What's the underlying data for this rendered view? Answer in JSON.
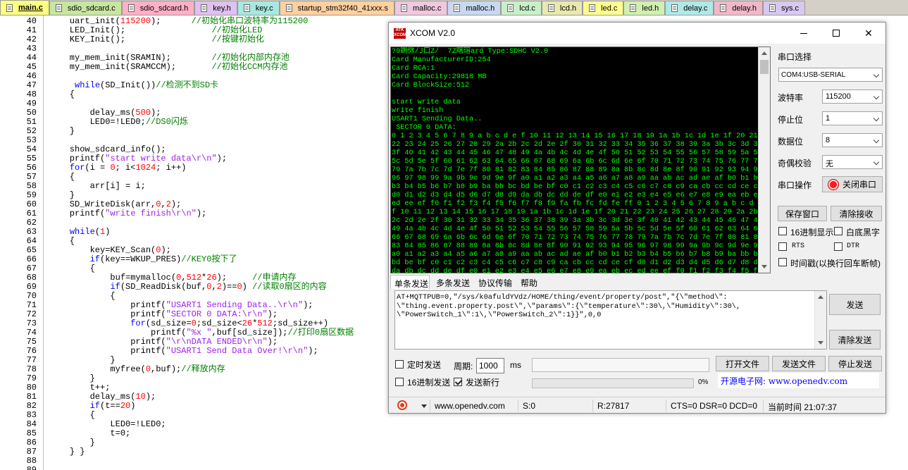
{
  "tabs": [
    {
      "label": "main.c",
      "color": "#ffff80",
      "active": true
    },
    {
      "label": "sdio_sdcard.c",
      "color": "#c8e6a0"
    },
    {
      "label": "sdio_sdcard.h",
      "color": "#ffb0c8"
    },
    {
      "label": "key.h",
      "color": "#e0c0f0"
    },
    {
      "label": "key.c",
      "color": "#a8e8e0"
    },
    {
      "label": "startup_stm32f40_41xxx.s",
      "color": "#ffd0a0"
    },
    {
      "label": "malloc.c",
      "color": "#f0c8e0"
    },
    {
      "label": "malloc.h",
      "color": "#c8d8f0"
    },
    {
      "label": "lcd.c",
      "color": "#c8f0c8"
    },
    {
      "label": "lcd.h",
      "color": "#e8e8b0"
    },
    {
      "label": "led.c",
      "color": "#ffff90"
    },
    {
      "label": "led.h",
      "color": "#d0f0b0"
    },
    {
      "label": "delay.c",
      "color": "#b0e8e8"
    },
    {
      "label": "delay.h",
      "color": "#f0b8c8"
    },
    {
      "label": "sys.c",
      "color": "#d8c8f0"
    }
  ],
  "code_lines": [
    {
      "n": "40",
      "t": [
        [
          "    uart_init(",
          ""
        ],
        [
          "115200",
          "numl"
        ],
        [
          ");      ",
          ""
        ],
        [
          "//初始化串口波特率为115200",
          "cmt"
        ]
      ]
    },
    {
      "n": "41",
      "t": [
        [
          "    LED_Init();                 ",
          ""
        ],
        [
          "//初始化LED",
          "cmt"
        ]
      ]
    },
    {
      "n": "42",
      "t": [
        [
          "    KEY_Init();                 ",
          ""
        ],
        [
          "//按键初始化",
          "cmt"
        ]
      ]
    },
    {
      "n": "43",
      "t": []
    },
    {
      "n": "44",
      "t": [
        [
          "    my_mem_init(SRAMIN);        ",
          ""
        ],
        [
          "//初始化内部内存池",
          "cmt"
        ]
      ]
    },
    {
      "n": "45",
      "t": [
        [
          "    my_mem_init(SRAMCCM);       ",
          ""
        ],
        [
          "//初始化CCM内存池",
          "cmt"
        ]
      ]
    },
    {
      "n": "46",
      "t": []
    },
    {
      "n": "47",
      "t": [
        [
          "     ",
          ""
        ],
        [
          "while",
          "kw"
        ],
        [
          "(SD_Init())",
          ""
        ],
        [
          "//检测不到SD卡",
          "cmt"
        ]
      ]
    },
    {
      "n": "48",
      "t": [
        [
          "    {",
          ""
        ]
      ]
    },
    {
      "n": "49",
      "t": []
    },
    {
      "n": "50",
      "t": [
        [
          "        delay_ms(",
          ""
        ],
        [
          "500",
          "numl"
        ],
        [
          ");",
          ""
        ]
      ]
    },
    {
      "n": "51",
      "t": [
        [
          "        LED0=!LED0;",
          ""
        ],
        [
          "//DS0闪烁",
          "cmt"
        ]
      ]
    },
    {
      "n": "52",
      "t": [
        [
          "    }",
          ""
        ]
      ]
    },
    {
      "n": "53",
      "t": []
    },
    {
      "n": "54",
      "t": [
        [
          "    show_sdcard_info();",
          ""
        ]
      ]
    },
    {
      "n": "55",
      "t": [
        [
          "    printf(",
          ""
        ],
        [
          "\"start write data\\r\\n\"",
          "str"
        ],
        [
          ");",
          ""
        ]
      ]
    },
    {
      "n": "56",
      "t": [
        [
          "    ",
          ""
        ],
        [
          "for",
          "kw"
        ],
        [
          "(i = ",
          ""
        ],
        [
          "0",
          "numl"
        ],
        [
          "; i<",
          ""
        ],
        [
          "1024",
          "numl"
        ],
        [
          "; i++)",
          ""
        ]
      ]
    },
    {
      "n": "57",
      "t": [
        [
          "    {",
          ""
        ]
      ]
    },
    {
      "n": "58",
      "t": [
        [
          "        arr[i] = i;",
          ""
        ]
      ]
    },
    {
      "n": "59",
      "t": [
        [
          "    }",
          ""
        ]
      ]
    },
    {
      "n": "60",
      "t": [
        [
          "    SD_WriteDisk(arr,",
          ""
        ],
        [
          "0",
          "numl"
        ],
        [
          ",",
          ""
        ],
        [
          "2",
          "numl"
        ],
        [
          ");",
          ""
        ]
      ]
    },
    {
      "n": "61",
      "t": [
        [
          "    printf(",
          ""
        ],
        [
          "\"write finish\\r\\n\"",
          "str"
        ],
        [
          ");",
          ""
        ]
      ]
    },
    {
      "n": "62",
      "t": []
    },
    {
      "n": "63",
      "t": [
        [
          "    ",
          ""
        ],
        [
          "while",
          "kw"
        ],
        [
          "(",
          ""
        ],
        [
          "1",
          "numl"
        ],
        [
          ")",
          ""
        ]
      ]
    },
    {
      "n": "64",
      "t": [
        [
          "    {",
          ""
        ]
      ]
    },
    {
      "n": "65",
      "t": [
        [
          "        key=KEY_Scan(",
          ""
        ],
        [
          "0",
          "numl"
        ],
        [
          ");",
          ""
        ]
      ]
    },
    {
      "n": "66",
      "t": [
        [
          "        ",
          ""
        ],
        [
          "if",
          "kw"
        ],
        [
          "(key==WKUP_PRES)",
          ""
        ],
        [
          "//KEY0按下了",
          "cmt"
        ]
      ]
    },
    {
      "n": "67",
      "t": [
        [
          "        {",
          ""
        ]
      ]
    },
    {
      "n": "68",
      "t": [
        [
          "            buf=mymalloc(",
          ""
        ],
        [
          "0",
          "numl"
        ],
        [
          ",",
          ""
        ],
        [
          "512",
          "numl"
        ],
        [
          "*",
          ""
        ],
        [
          "26",
          "numl"
        ],
        [
          ");     ",
          ""
        ],
        [
          "//申请内存",
          "cmt"
        ]
      ]
    },
    {
      "n": "69",
      "t": [
        [
          "            ",
          ""
        ],
        [
          "if",
          "kw"
        ],
        [
          "(SD_ReadDisk(buf,",
          ""
        ],
        [
          "0",
          "numl"
        ],
        [
          ",",
          ""
        ],
        [
          "2",
          "numl"
        ],
        [
          ")==",
          ""
        ],
        [
          "0",
          "numl"
        ],
        [
          ") ",
          ""
        ],
        [
          "//读取0扇区的内容",
          "cmt"
        ]
      ]
    },
    {
      "n": "70",
      "t": [
        [
          "            {",
          ""
        ]
      ]
    },
    {
      "n": "71",
      "t": [
        [
          "                printf(",
          ""
        ],
        [
          "\"USART1 Sending Data..\\r\\n\"",
          "str"
        ],
        [
          ");",
          ""
        ]
      ]
    },
    {
      "n": "72",
      "t": [
        [
          "                printf(",
          ""
        ],
        [
          "\"SECTOR 0 DATA:\\r\\n\"",
          "str"
        ],
        [
          ");",
          ""
        ]
      ]
    },
    {
      "n": "73",
      "t": [
        [
          "                ",
          ""
        ],
        [
          "for",
          "kw"
        ],
        [
          "(sd_size=",
          ""
        ],
        [
          "0",
          "numl"
        ],
        [
          ";sd_size<",
          ""
        ],
        [
          "26",
          "numl"
        ],
        [
          "*",
          ""
        ],
        [
          "512",
          "numl"
        ],
        [
          ";sd_size++)",
          ""
        ]
      ]
    },
    {
      "n": "74",
      "t": [
        [
          "                    printf(",
          ""
        ],
        [
          "\"%x \"",
          "str"
        ],
        [
          ",buf[sd_size]);",
          ""
        ],
        [
          "//打印0扇区数据",
          "cmt"
        ]
      ]
    },
    {
      "n": "75",
      "t": [
        [
          "                printf(",
          ""
        ],
        [
          "\"\\r\\nDATA ENDED\\r\\n\"",
          "str"
        ],
        [
          ");",
          ""
        ]
      ]
    },
    {
      "n": "76",
      "t": [
        [
          "                printf(",
          ""
        ],
        [
          "\"USART1 Send Data Over!\\r\\n\"",
          "str"
        ],
        [
          ");",
          ""
        ]
      ]
    },
    {
      "n": "77",
      "t": [
        [
          "            }",
          ""
        ]
      ]
    },
    {
      "n": "78",
      "t": [
        [
          "            myfree(",
          ""
        ],
        [
          "0",
          "numl"
        ],
        [
          ",buf);",
          ""
        ],
        [
          "//释放内存",
          "cmt"
        ]
      ]
    },
    {
      "n": "79",
      "t": [
        [
          "        }",
          ""
        ]
      ]
    },
    {
      "n": "80",
      "t": [
        [
          "        t++;",
          ""
        ]
      ]
    },
    {
      "n": "81",
      "t": [
        [
          "        delay_ms(",
          ""
        ],
        [
          "10",
          "numl"
        ],
        [
          ");",
          ""
        ]
      ]
    },
    {
      "n": "82",
      "t": [
        [
          "        ",
          ""
        ],
        [
          "if",
          "kw"
        ],
        [
          "(t==",
          ""
        ],
        [
          "20",
          "numl"
        ],
        [
          ")",
          ""
        ]
      ]
    },
    {
      "n": "83",
      "t": [
        [
          "        {",
          ""
        ]
      ]
    },
    {
      "n": "84",
      "t": [
        [
          "            LED0=!LED0;",
          ""
        ]
      ]
    },
    {
      "n": "85",
      "t": [
        [
          "            t=0;",
          ""
        ]
      ]
    },
    {
      "n": "86",
      "t": [
        [
          "        }",
          ""
        ]
      ]
    },
    {
      "n": "87",
      "t": [
        [
          "    } }",
          ""
        ]
      ]
    },
    {
      "n": "88",
      "t": []
    },
    {
      "n": "89",
      "t": []
    }
  ],
  "xcom": {
    "title": "XCOM V2.0",
    "logo_text": "ATK XCOM",
    "receive_lines": [
      "?9鍘傚/J口Z/  7Z瞎瑢ard Type:SDHC V2.0",
      "Card ManufacturerID:254",
      "Card RCA:1",
      "Card Capacity:29818 MB",
      "Card BlockSize:512",
      "",
      "start write data",
      "write finish",
      "USART1 Sending Data..",
      " SECTOR 0 DATA:",
      "0 1 2 3 4 5 6 7 8 9 a b c d e f 10 11 12 13 14 15 16 17 18 19 1a 1b 1c 1d 1e 1f 20 21",
      "22 23 24 25 26 27 28 29 2a 2b 2c 2d 2e 2f 30 31 32 33 34 35 36 37 38 39 3a 3b 3c 3d 3e",
      "3f 40 41 42 43 44 45 46 47 48 49 4a 4b 4c 4d 4e 4f 50 51 52 53 54 55 56 57 58 59 5a 5b",
      "5c 5d 5e 5f 60 61 62 63 64 65 66 67 68 69 6a 6b 6c 6d 6e 6f 70 71 72 73 74 75 76 77 78",
      "79 7a 7b 7c 7d 7e 7f 80 81 82 83 84 85 86 87 88 89 8a 8b 8c 8d 8e 8f 90 91 92 93 94 95",
      "96 97 98 99 9a 9b 9c 9d 9e 9f a0 a1 a2 a3 a4 a5 a6 a7 a8 a9 aa ab ac ad ae af b0 b1 b2",
      "b3 b4 b5 b6 b7 b8 b9 ba bb bc bd be bf c0 c1 c2 c3 c4 c5 c6 c7 c8 c9 ca cb cc cd ce cf",
      "d0 d1 d2 d3 d4 d5 d6 d7 d8 d9 da db dc dd de df e0 e1 e2 e3 e4 e5 e6 e7 e8 e9 ea eb ec",
      "ed ee ef f0 f1 f2 f3 f4 f5 f6 f7 f8 f9 fa fb fc fd fe ff 0 1 2 3 4 5 6 7 8 9 a b c d e",
      "f 10 11 12 13 14 15 16 17 18 19 1a 1b 1c 1d 1e 1f 20 21 22 23 24 25 26 27 28 29 2a 2b",
      "2c 2d 2e 2f 30 31 32 33 34 35 36 37 38 39 3a 3b 3c 3d 3e 3f 40 41 42 43 44 45 46 47 48",
      "49 4a 4b 4c 4d 4e 4f 50 51 52 53 54 55 56 57 58 59 5a 5b 5c 5d 5e 5f 60 61 62 63 64 65",
      "66 67 68 69 6a 6b 6c 6d 6e 6f 70 71 72 73 74 75 76 77 78 79 7a 7b 7c 7d 7e 7f 80 81 82",
      "83 84 85 86 87 88 89 8a 8b 8c 8d 8e 8f 90 91 92 93 94 95 96 97 98 99 9a 9b 9c 9d 9e 9f",
      "a0 a1 a2 a3 a4 a5 a6 a7 a8 a9 aa ab ac ad ae af b0 b1 b2 b3 b4 b5 b6 b7 b8 b9 ba bb bc",
      "bd be bf c0 c1 c2 c3 c4 c5 c6 c7 c8 c9 ca cb cc cd ce cf d0 d1 d2 d3 d4 d5 d6 d7 d8 d9",
      "da db dc dd de df e0 e1 e2 e3 e4 e5 e6 e7 e8 e9 ea eb ec ed ee ef f0 f1 f2 f3 f4 f5 f6"
    ],
    "port_label": "串口选择",
    "port_value": "COM4:USB-SERIAL",
    "baud_label": "波特率",
    "baud_value": "115200",
    "stop_label": "停止位",
    "stop_value": "1",
    "data_label": "数据位",
    "data_value": "8",
    "parity_label": "奇偶校验",
    "parity_value": "无",
    "op_label": "串口操作",
    "close_port": "关闭串口",
    "save_window": "保存窗口",
    "clear_recv": "清除接收",
    "hex_display": "16进制显示",
    "white_black": "白底黑字",
    "rts": "RTS",
    "dtr": "DTR",
    "timestamp": "时间戳(以换行回车断帧)",
    "send_tabs": [
      "单条发送",
      "多条发送",
      "协议传输",
      "帮助"
    ],
    "send_lines": [
      "AT+MQTTPUB=0,\"/sys/k0afuldYVdz/HOME/thing/event/property/post\",\"{\\\"method\\\":",
      "\\\"thing.event.property.post\\\",\\\"params\\\":{\\\"temperature\\\":30\\,\\\"Humidity\\\":30\\,",
      "\\\"PowerSwitch_1\\\":1\\,\\\"PowerSwitch_2\\\":1}}\",0,0"
    ],
    "send_btn": "发送",
    "clear_send": "清除发送",
    "timed_send": "定时发送",
    "period_label": "周期:",
    "period_value": "1000",
    "ms": "ms",
    "open_file": "打开文件",
    "send_file": "发送文件",
    "stop_send": "停止发送",
    "hex_send": "16进制发送",
    "send_newline": "发送新行",
    "percent": "0%",
    "website": "开源电子网: www.openedv.com",
    "status_url": "www.openedv.com",
    "status_s": "S:0",
    "status_r": "R:27817",
    "status_lines": "CTS=0 DSR=0 DCD=0",
    "status_time": "当前时间 21:07:37"
  }
}
